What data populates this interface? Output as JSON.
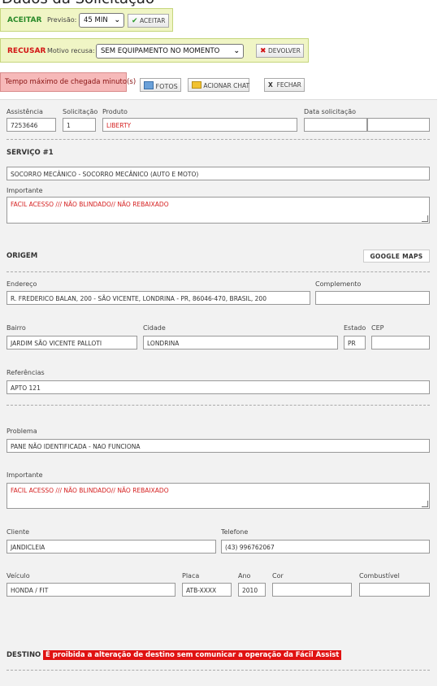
{
  "page_title": "Dados da Solicitação",
  "accept": {
    "label": "ACEITAR",
    "previsao_label": "Previsão:",
    "previsao_value": "45 MIN",
    "button": "ACEITAR"
  },
  "refuse": {
    "label": "RECUSAR",
    "motivo_label": "Motivo recusa:",
    "motivo_value": "SEM EQUIPAMENTO NO MOMENTO",
    "button": "DEVOLVER"
  },
  "timer_label": "Tempo máximo de chegada minuto(s)",
  "actions": {
    "photos": "FOTOS",
    "chat": "ACIONAR CHAT",
    "close": "FECHAR",
    "close_x": "X"
  },
  "request": {
    "assistencia_label": "Assistência",
    "assistencia": "7253646",
    "solicitacao_label": "Solicitação",
    "solicitacao": "1",
    "produto_label": "Produto",
    "produto": "LIBERTY",
    "data_label": "Data solicitação",
    "data": "",
    "hora": ""
  },
  "service": {
    "heading": "SERVIÇO #1",
    "value": "SOCORRO MECÂNICO - SOCORRO MECÂNICO (AUTO E MOTO)",
    "importante_label": "Importante",
    "importante": "FACIL ACESSO /// NÃO BLINDADO// NÃO REBAIXADO"
  },
  "origin": {
    "heading": "ORIGEM",
    "maps_button": "GOOGLE MAPS",
    "endereco_label": "Endereço",
    "endereco": "R. FREDERICO BALAN, 200 - SÃO VICENTE, LONDRINA - PR, 86046-470, BRASIL, 200",
    "complemento_label": "Complemento",
    "complemento": "",
    "bairro_label": "Bairro",
    "bairro": "JARDIM SÃO VICENTE PALLOTI",
    "cidade_label": "Cidade",
    "cidade": "LONDRINA",
    "estado_label": "Estado",
    "estado": "PR",
    "cep_label": "CEP",
    "cep": "",
    "referencias_label": "Referências",
    "referencias": "APTO  121"
  },
  "problem": {
    "problema_label": "Problema",
    "problema": "PANE NÃO IDENTIFICADA - NAO FUNCIONA",
    "importante_label": "Importante",
    "importante": "FACIL ACESSO /// NÃO BLINDADO// NÃO REBAIXADO",
    "cliente_label": "Cliente",
    "cliente": "JANDICLEIA",
    "telefone_label": "Telefone",
    "telefone": "(43) 996762067",
    "veiculo_label": "Veículo",
    "veiculo": "HONDA / FIT",
    "placa_label": "Placa",
    "placa": "ATB-XXXX",
    "ano_label": "Ano",
    "ano": "2010",
    "cor_label": "Cor",
    "cor": "",
    "combustivel_label": "Combustível",
    "combustivel": ""
  },
  "destination": {
    "heading": "DESTINO",
    "warning": "É proibida a alteração de destino sem comunicar a operação da Fácil Assist"
  },
  "colors": {
    "accept_green": "#2a8a2a",
    "refuse_red": "#d21414",
    "warning_red": "#e01212",
    "timer_bg": "#f6b9b9",
    "box_bg": "#f0f5c5"
  }
}
